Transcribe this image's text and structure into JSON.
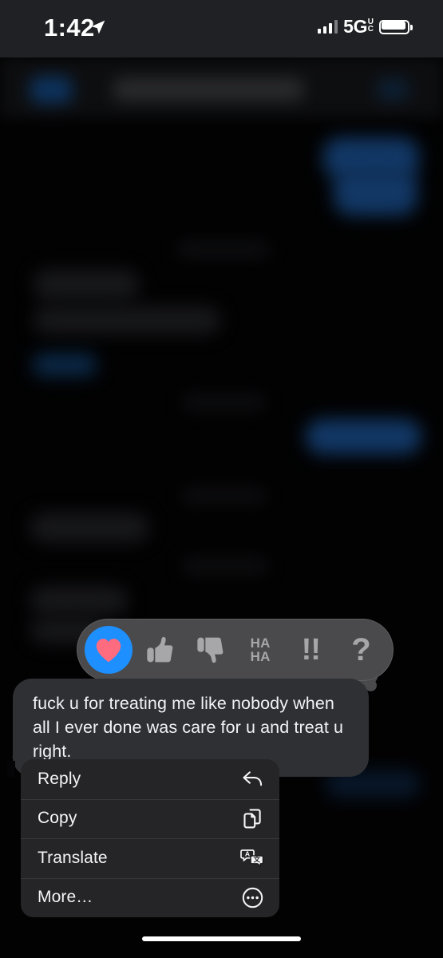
{
  "status_bar": {
    "time": "1:42",
    "location_icon": "location-arrow-icon",
    "signal_icon": "cellular-signal-icon",
    "network_main": "5G",
    "network_sub_top": "U",
    "network_sub_bottom": "C",
    "battery_icon": "battery-full-icon"
  },
  "navbar": {
    "back_label": "",
    "contact_name": "",
    "note": "blurred"
  },
  "tapback": {
    "items": [
      {
        "name": "heart",
        "glyph": "♥",
        "selected": true
      },
      {
        "name": "thumbs-up",
        "glyph": "👍",
        "selected": false
      },
      {
        "name": "thumbs-down",
        "glyph": "👎",
        "selected": false
      },
      {
        "name": "haha",
        "line1": "HA",
        "line2": "HA",
        "selected": false
      },
      {
        "name": "exclamation",
        "glyph": "!!",
        "selected": false
      },
      {
        "name": "question",
        "glyph": "?",
        "selected": false
      }
    ],
    "selected_color": "#1d8fff",
    "heart_color": "#ff6b7f",
    "bar_color": "#4a4a4c"
  },
  "message": {
    "text": "fuck u for treating me like nobody when all I ever done was care for u and treat u right.",
    "direction": "received",
    "bubble_color": "#2f3034",
    "text_color": "#f2f2f4"
  },
  "context_menu": {
    "items": [
      {
        "label": "Reply",
        "icon": "reply-arrow-icon"
      },
      {
        "label": "Copy",
        "icon": "copy-documents-icon"
      },
      {
        "label": "Translate",
        "icon": "translate-bubbles-icon"
      },
      {
        "label": "More…",
        "icon": "ellipsis-circle-icon"
      }
    ],
    "background": "#252527"
  },
  "home_indicator": {
    "name": "home-indicator",
    "color": "#ffffff"
  }
}
